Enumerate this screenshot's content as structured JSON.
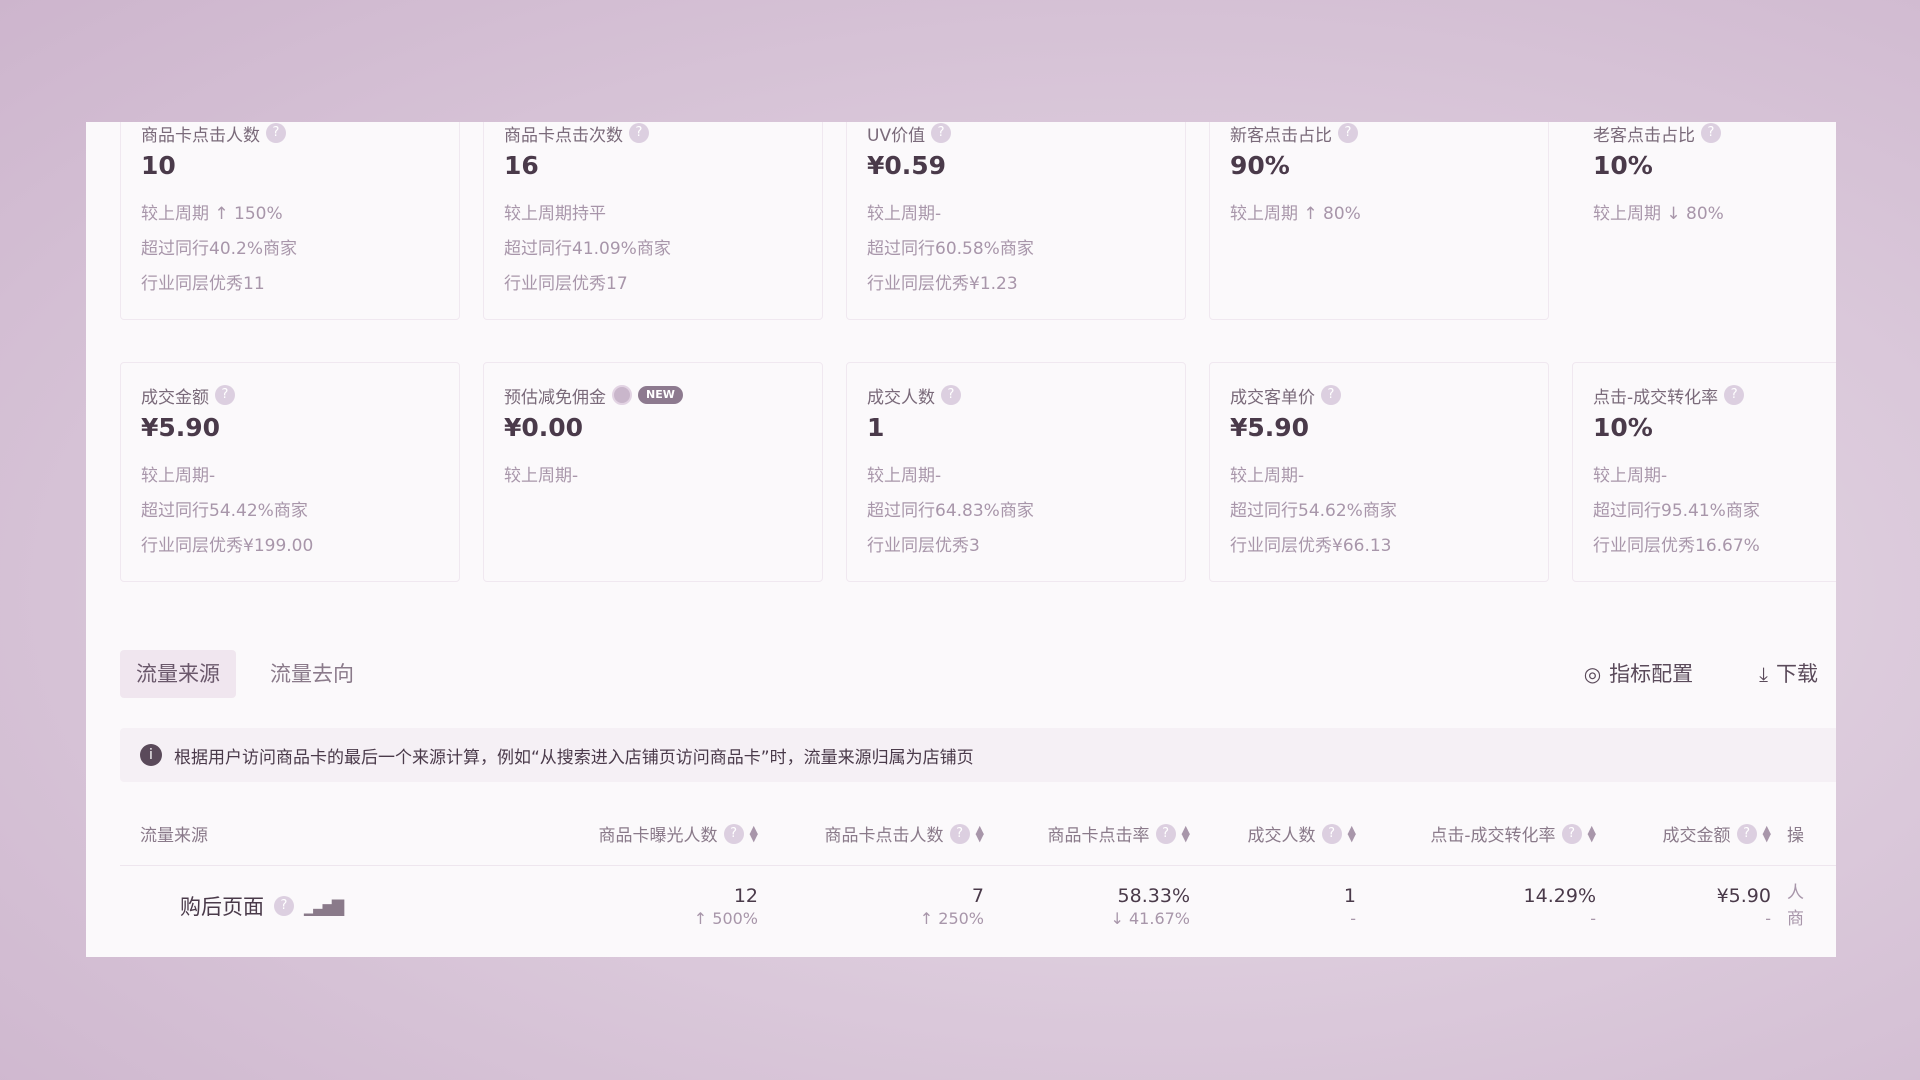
{
  "metrics_row1": [
    {
      "label": "商品卡点击人数",
      "value": "10",
      "lines": [
        "较上周期 ↑ 150%",
        "超过同行40.2%商家",
        "行业同层优秀11"
      ]
    },
    {
      "label": "商品卡点击次数",
      "value": "16",
      "lines": [
        "较上周期持平",
        "超过同行41.09%商家",
        "行业同层优秀17"
      ]
    },
    {
      "label": "UV价值",
      "value": "¥0.59",
      "lines": [
        "较上周期-",
        "超过同行60.58%商家",
        "行业同层优秀¥1.23"
      ]
    },
    {
      "label": "新客点击占比",
      "value": "90%",
      "lines": [
        "较上周期 ↑ 80%"
      ]
    },
    {
      "label": "老客点击占比",
      "value": "10%",
      "lines": [
        "较上周期 ↓ 80%"
      ]
    }
  ],
  "metrics_row2": [
    {
      "label": "成交金额",
      "value": "¥5.90",
      "lines": [
        "较上周期-",
        "超过同行54.42%商家",
        "行业同层优秀¥199.00"
      ]
    },
    {
      "label": "预估减免佣金",
      "value": "¥0.00",
      "badge": "NEW",
      "lines": [
        "较上周期-"
      ]
    },
    {
      "label": "成交人数",
      "value": "1",
      "lines": [
        "较上周期-",
        "超过同行64.83%商家",
        "行业同层优秀3"
      ]
    },
    {
      "label": "成交客单价",
      "value": "¥5.90",
      "lines": [
        "较上周期-",
        "超过同行54.62%商家",
        "行业同层优秀¥66.13"
      ]
    },
    {
      "label": "点击-成交转化率",
      "value": "10%",
      "lines": [
        "较上周期-",
        "超过同行95.41%商家",
        "行业同层优秀16.67%"
      ]
    }
  ],
  "tabs": {
    "source": "流量来源",
    "destination": "流量去向"
  },
  "actions": {
    "config": "指标配置",
    "download": "下载"
  },
  "notice": "根据用户访问商品卡的最后一个来源计算，例如“从搜索进入店铺页访问商品卡”时，流量来源归属为店铺页",
  "table": {
    "headers": {
      "source": "流量来源",
      "exposure": "商品卡曝光人数",
      "clicks": "商品卡点击人数",
      "ctr": "商品卡点击率",
      "buyers": "成交人数",
      "conversion": "点击-成交转化率",
      "amount": "成交金额",
      "op": "操"
    },
    "rows": [
      {
        "source": "购后页面",
        "exposure": "12",
        "exposure_sub": "↑ 500%",
        "clicks": "7",
        "clicks_sub": "↑ 250%",
        "ctr": "58.33%",
        "ctr_sub": "↓ 41.67%",
        "buyers": "1",
        "buyers_sub": "-",
        "conversion": "14.29%",
        "conversion_sub": "-",
        "amount": "¥5.90",
        "amount_sub": "-",
        "op_line1": "人",
        "op_line2": "商"
      }
    ]
  }
}
